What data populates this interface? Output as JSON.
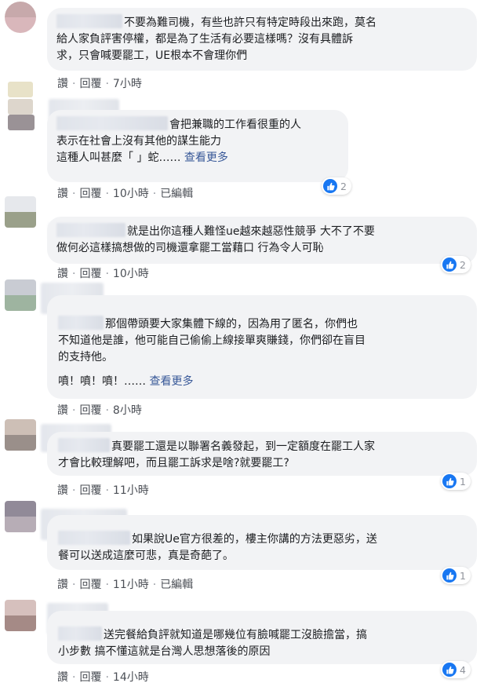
{
  "comments": [
    {
      "lines": [
        "不要為難司機，有些也許只有特定時段出來跑，莫名",
        "給人家負評害停權，都是為了生活有必要這樣嗎？沒有具體訴",
        "求，只會喊要罷工，UE根本不會理你們"
      ],
      "see_more": "",
      "actions": {
        "like": "讚",
        "reply": "回覆",
        "time": "7小時",
        "edited": ""
      },
      "reactions": ""
    },
    {
      "lines": [
        "會把兼職的工作看很重的人",
        "表示在社會上沒有其他的謀生能力",
        "這種人叫甚麼「 」蛇……"
      ],
      "see_more": "查看更多",
      "actions": {
        "like": "讚",
        "reply": "回覆",
        "time": "10小時",
        "edited": "已編輯"
      },
      "reactions": "2"
    },
    {
      "lines": [
        "就是出你這種人難怪ue越來越惡性競爭 大不了不要",
        "做何必這樣搞想做的司機還拿罷工當藉口 行為令人可恥"
      ],
      "see_more": "",
      "actions": {
        "like": "讚",
        "reply": "回覆",
        "time": "10小時",
        "edited": ""
      },
      "reactions": "2"
    },
    {
      "lines": [
        "那個帶頭要大家集體下線的，因為用了匿名，你們也",
        "不知道他是誰，他可能自己偷偷上線接單爽賺錢，你們卻在盲目",
        "的支持他。",
        "",
        "噴！噴！噴！……"
      ],
      "see_more": "查看更多",
      "actions": {
        "like": "讚",
        "reply": "回覆",
        "time": "8小時",
        "edited": ""
      },
      "reactions": ""
    },
    {
      "lines": [
        "真要罷工還是以聯署名義發起，到一定額度在罷工人家",
        "才會比較理解吧，而且罷工訴求是啥?就要罷工?"
      ],
      "see_more": "",
      "actions": {
        "like": "讚",
        "reply": "回覆",
        "time": "11小時",
        "edited": ""
      },
      "reactions": "1"
    },
    {
      "lines": [
        "如果說Ue官方很差的，樓主你講的方法更惡劣，送",
        "餐可以送成這麼可悲，真是奇葩了。"
      ],
      "see_more": "",
      "actions": {
        "like": "讚",
        "reply": "回覆",
        "time": "11小時",
        "edited": "已編輯"
      },
      "reactions": "1"
    },
    {
      "lines": [
        "送完餐給負評就知道是哪幾位有臉喊罷工沒臉擔當，搞",
        "小步數 搞不懂這就是台灣人思想落後的原因"
      ],
      "see_more": "",
      "actions": {
        "like": "讚",
        "reply": "回覆",
        "time": "14小時",
        "edited": ""
      },
      "reactions": "4"
    }
  ],
  "colors": {
    "like_blue": "#1877f2",
    "link": "#385898",
    "bubble": "#f2f3f5",
    "meta": "#4b4f56"
  }
}
